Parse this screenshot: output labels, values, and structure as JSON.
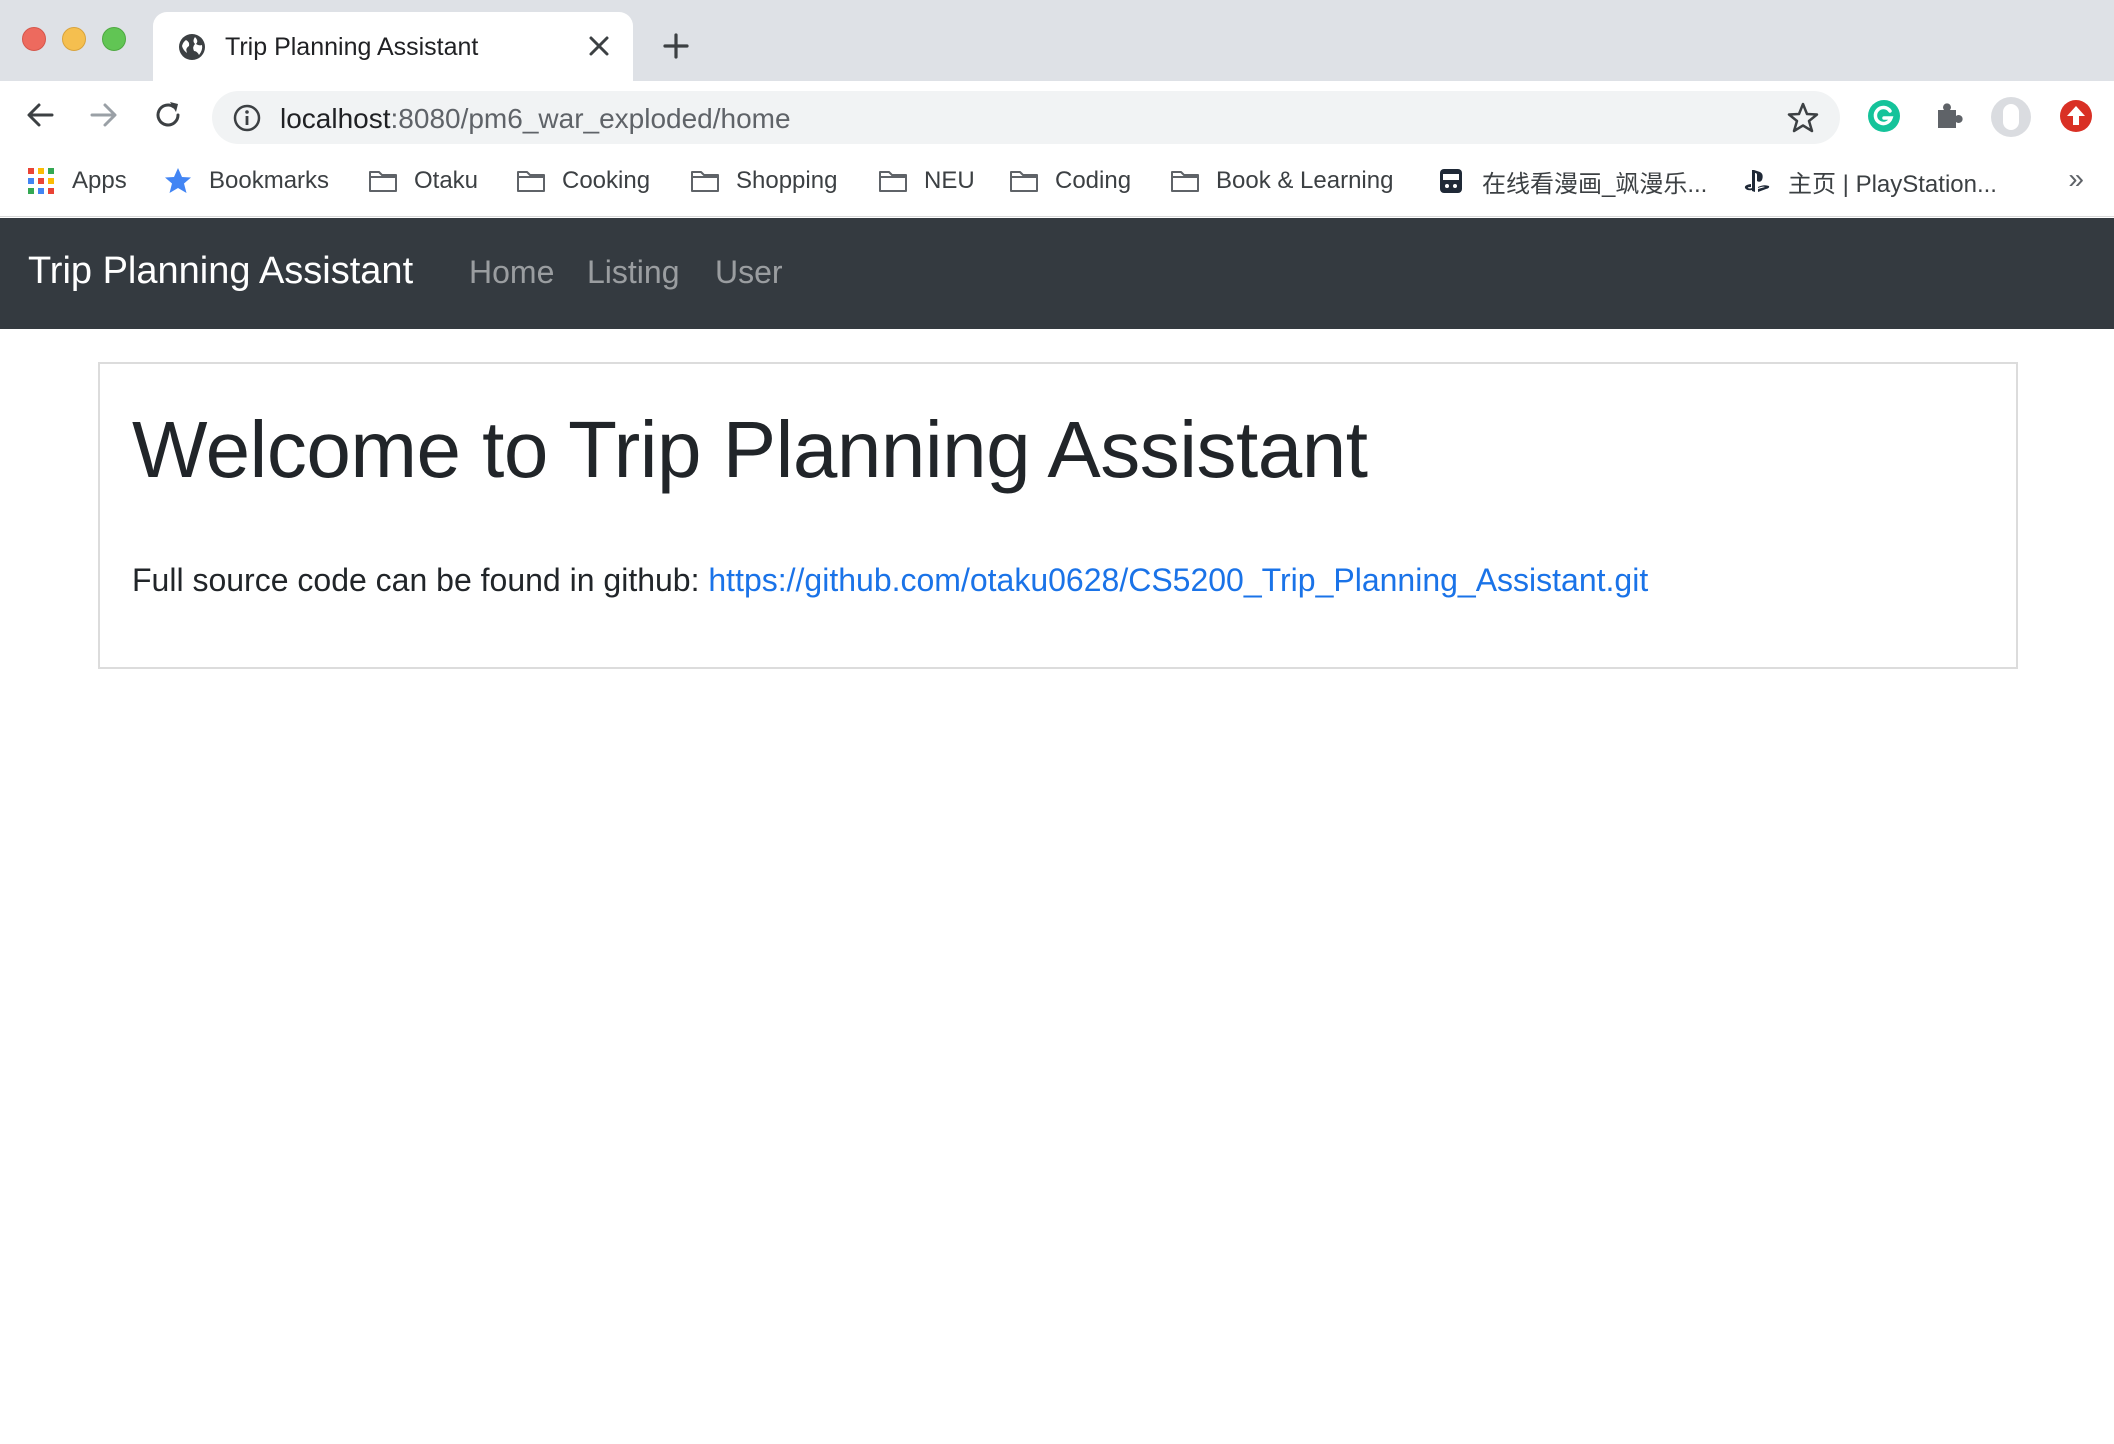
{
  "browser": {
    "tab": {
      "title": "Trip Planning Assistant"
    },
    "address": {
      "host": "localhost",
      "path": ":8080/pm6_war_exploded/home"
    },
    "bookmarks": [
      {
        "label": "Apps",
        "icon": "apps-grid-icon"
      },
      {
        "label": "Bookmarks",
        "icon": "star-icon"
      },
      {
        "label": "Otaku",
        "icon": "folder-icon"
      },
      {
        "label": "Cooking",
        "icon": "folder-icon"
      },
      {
        "label": "Shopping",
        "icon": "folder-icon"
      },
      {
        "label": "NEU",
        "icon": "folder-icon"
      },
      {
        "label": "Coding",
        "icon": "folder-icon"
      },
      {
        "label": "Book & Learning",
        "icon": "folder-icon"
      },
      {
        "label": "在线看漫画_飒漫乐...",
        "icon": "manga-site-icon"
      },
      {
        "label": "主页 | PlayStation...",
        "icon": "playstation-icon"
      }
    ],
    "more_label": "»"
  },
  "navbar": {
    "brand": "Trip Planning Assistant",
    "links": [
      "Home",
      "Listing",
      "User"
    ]
  },
  "main": {
    "title": "Welcome to Trip Planning Assistant",
    "text": "Full source code can be found in github: ",
    "link": "https://github.com/otaku0628/CS5200_Trip_Planning_Assistant.git"
  },
  "colors": {
    "navbar_bg": "#343a40",
    "link": "#1a73e8",
    "tabstrip": "#dee1e6"
  }
}
